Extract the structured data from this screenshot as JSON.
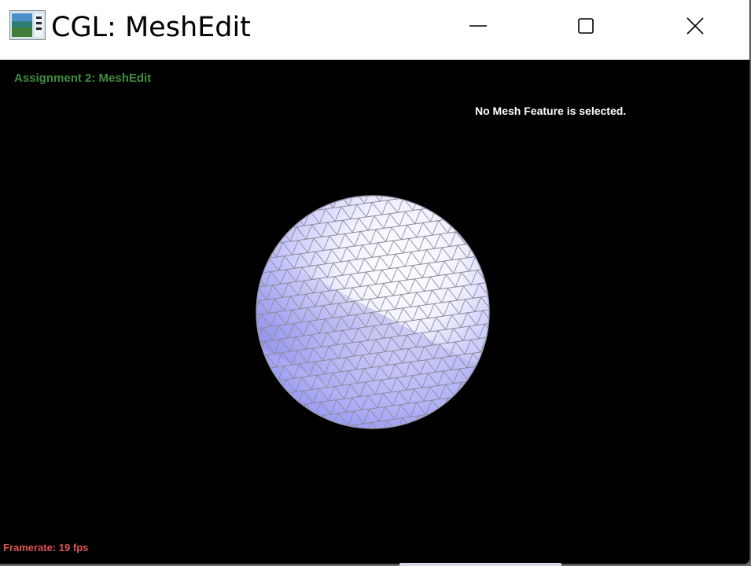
{
  "window": {
    "title": "CGL: MeshEdit",
    "app_icon": "cgl-app-icon",
    "controls": {
      "minimize_icon": "minimize-icon",
      "maximize_icon": "maximize-icon",
      "close_icon": "close-icon"
    }
  },
  "hud": {
    "assignment_title": "Assignment 2: MeshEdit",
    "selection_status": "No Mesh Feature is selected.",
    "framerate": "Framerate: 19 fps"
  },
  "colors": {
    "title_green": "#3f8e3f",
    "framerate_red": "#e05555",
    "mesh_light": "#ffffff",
    "mesh_shade": "#8f8ff5",
    "mesh_wire": "#8a8a9a"
  }
}
